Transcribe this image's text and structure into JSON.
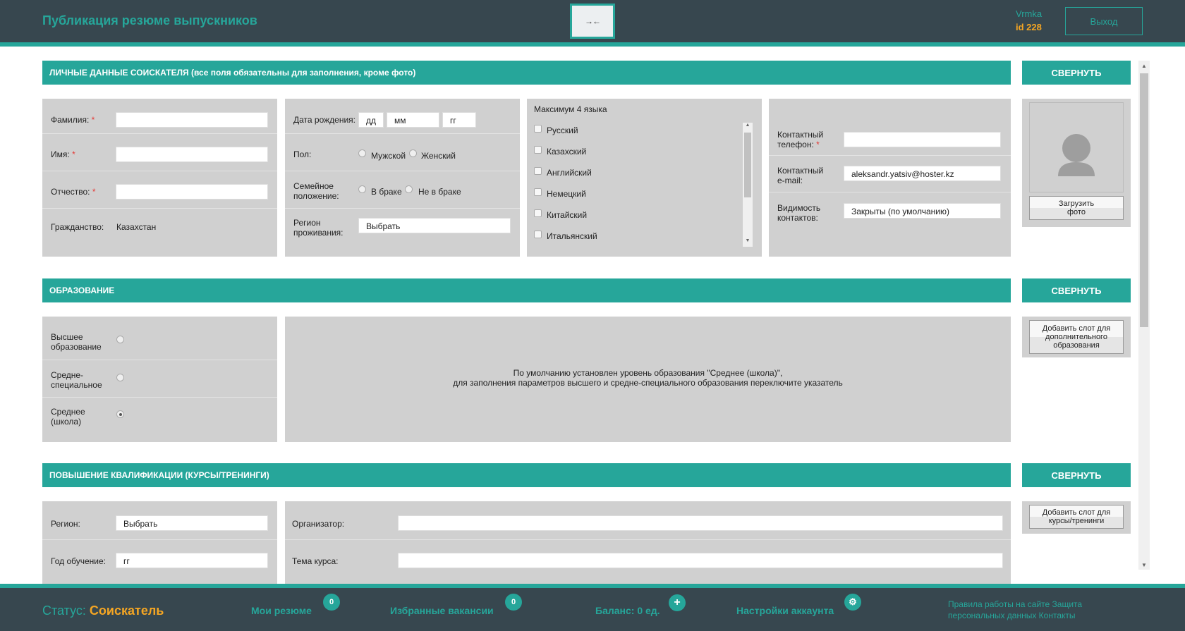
{
  "header": {
    "title": "Публикация резюме выпускников",
    "toggle_label": "→←",
    "user_name": "Vrmka",
    "user_id": "id 228",
    "logout_label": "Выход"
  },
  "personal": {
    "section_title": "ЛИЧНЫЕ ДАННЫЕ СОИСКАТЕЛЯ (все поля обязательны для заполнения, кроме фото)",
    "collapse_label": "СВЕРНУТЬ",
    "surname_label": "Фамилия:",
    "name_label": "Имя:",
    "patronymic_label": "Отчество:",
    "required_mark": "*",
    "citizenship_label": "Гражданство:",
    "citizenship_value": "Казахстан",
    "birthdate_label": "Дата рождения:",
    "day_placeholder": "дд",
    "month_placeholder": "мм",
    "year_placeholder": "гг",
    "gender_label": "Пол:",
    "gender_male": "Мужской",
    "gender_female": "Женский",
    "marital_label_1": "Семейное",
    "marital_label_2": "положение:",
    "marital_married": "В браке",
    "marital_single": "Не в браке",
    "region_label_1": "Регион",
    "region_label_2": "проживания:",
    "region_value": "Выбрать",
    "languages_title": "Максимум 4 языка",
    "languages": [
      "Русский",
      "Казахский",
      "Английский",
      "Немецкий",
      "Китайский",
      "Итальянский"
    ],
    "phone_label_1": "Контактный",
    "phone_label_2": "телефон:",
    "email_label_1": "Контактный",
    "email_label_2": "e-mail:",
    "email_value": "aleksandr.yatsiv@hoster.kz",
    "visibility_label_1": "Видимость",
    "visibility_label_2": "контактов:",
    "visibility_value": "Закрыты (по умолчанию)",
    "upload_label_1": "Загрузить",
    "upload_label_2": "фото"
  },
  "education": {
    "section_title": "ОБРАЗОВАНИЕ",
    "collapse_label": "СВЕРНУТЬ",
    "higher_1": "Высшее",
    "higher_2": "образование",
    "special_1": "Средне-",
    "special_2": "специальное",
    "school_1": "Среднее",
    "school_2": "(школа)",
    "info_line_1": "По умолчанию установлен уровень образования \"Среднее (школа)\",",
    "info_line_2": "для заполнения параметров высшего и средне-специального образования переключите указатель",
    "add_slot_label": "Добавить слот для дополнительного образования"
  },
  "courses": {
    "section_title": "ПОВЫШЕНИЕ КВАЛИФИКАЦИИ (КУРСЫ/ТРЕНИНГИ)",
    "collapse_label": "СВЕРНУТЬ",
    "region_label": "Регион:",
    "region_value": "Выбрать",
    "year_label": "Год обучение:",
    "year_value": "гг",
    "organizer_label": "Организатор:",
    "topic_label": "Тема курса:",
    "add_slot_label": "Добавить слот для курсы/тренинги"
  },
  "footer": {
    "status_label": "Статус:",
    "status_value": "Соискатель",
    "my_resumes": "Мои резюме",
    "my_resumes_count": "0",
    "fav_vacancies": "Избранные вакансии",
    "fav_vacancies_count": "0",
    "balance": "Баланс: 0 ед.",
    "balance_icon": "+",
    "settings": "Настройки аккаунта",
    "settings_icon": "⚙",
    "links_text": "Правила работы на сайте Защита персональных данных Контакты"
  }
}
